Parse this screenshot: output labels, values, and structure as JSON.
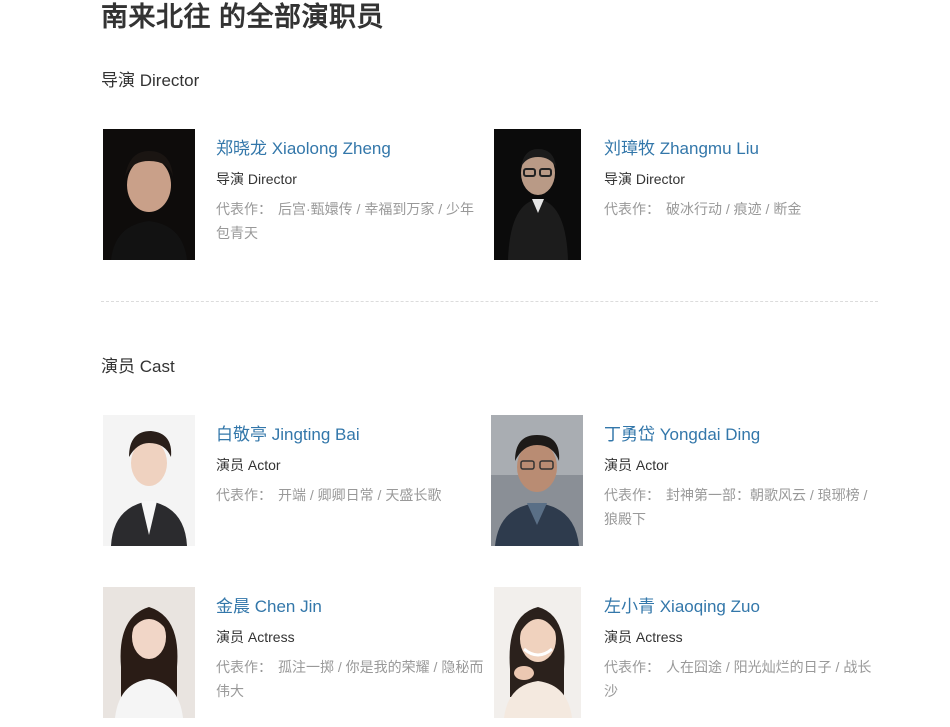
{
  "title": "南来北往 的全部演职员",
  "sections": {
    "director": {
      "title": "导演 Director"
    },
    "cast": {
      "title": "演员 Cast"
    }
  },
  "works_label": "代表作：",
  "people": [
    {
      "name": "郑晓龙 Xiaolong Zheng",
      "role": "导演 Director",
      "works": [
        "后宫·甄嬛传",
        "幸福到万家",
        "少年包青天"
      ],
      "photo_desc": "photo-zheng"
    },
    {
      "name": "刘璋牧 Zhangmu Liu",
      "role": "导演 Director",
      "works": [
        "破冰行动",
        "痕迹",
        "断金"
      ],
      "photo_desc": "photo-liu"
    },
    {
      "name": "白敬亭 Jingting Bai",
      "role": "演员 Actor",
      "works": [
        "开端",
        "卿卿日常",
        "天盛长歌"
      ],
      "photo_desc": "photo-bai"
    },
    {
      "name": "丁勇岱 Yongdai Ding",
      "role": "演员 Actor",
      "works": [
        "封神第一部：朝歌风云",
        "琅琊榜",
        "狼殿下"
      ],
      "photo_desc": "photo-ding"
    },
    {
      "name": "金晨 Chen Jin",
      "role": "演员 Actress",
      "works": [
        "孤注一掷",
        "你是我的荣耀",
        "隐秘而伟大"
      ],
      "photo_desc": "photo-jin"
    },
    {
      "name": "左小青 Xiaoqing Zuo",
      "role": "演员 Actress",
      "works": [
        "人在囧途",
        "阳光灿烂的日子",
        "战长沙"
      ],
      "photo_desc": "photo-zuo"
    }
  ]
}
